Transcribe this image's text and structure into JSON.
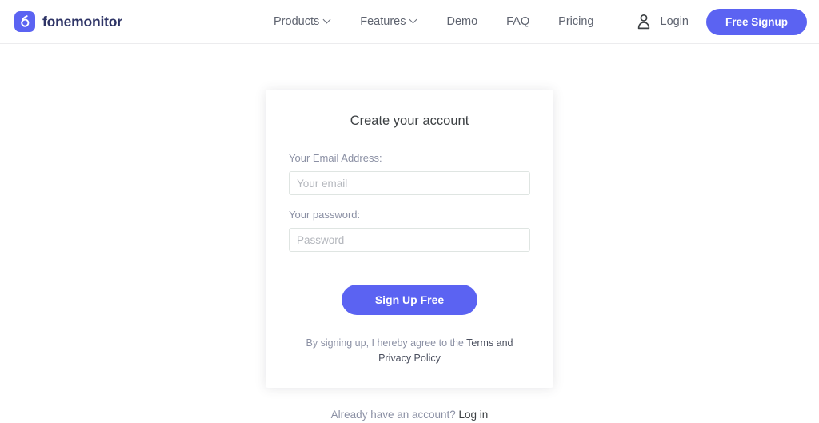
{
  "header": {
    "brand": {
      "icon": "fonemonitor-logo-icon",
      "name": "fonemonitor",
      "color": "#5b63f2"
    },
    "nav": [
      {
        "label": "Products",
        "has_dropdown": true
      },
      {
        "label": "Features",
        "has_dropdown": true
      },
      {
        "label": "Demo",
        "has_dropdown": false
      },
      {
        "label": "FAQ",
        "has_dropdown": false
      },
      {
        "label": "Pricing",
        "has_dropdown": false
      }
    ],
    "account_icon": "user-icon",
    "login_label": "Login",
    "signup_button": "Free Signup"
  },
  "signup_card": {
    "title": "Create your account",
    "email": {
      "label": "Your Email Address:",
      "placeholder": "Your email",
      "value": ""
    },
    "password": {
      "label": "Your password:",
      "placeholder": "Password",
      "value": ""
    },
    "submit_label": "Sign Up Free",
    "terms_prefix": "By signing up, I hereby agree to the ",
    "terms_link": "Terms and Privacy Policy"
  },
  "footer": {
    "prompt": "Already have an account? ",
    "login_link": "Log in"
  },
  "colors": {
    "accent": "#5b63f2",
    "brand_text": "#2e3466",
    "label": "#8b90a4",
    "body_text": "#3c4043",
    "border": "#dfe5e2"
  }
}
